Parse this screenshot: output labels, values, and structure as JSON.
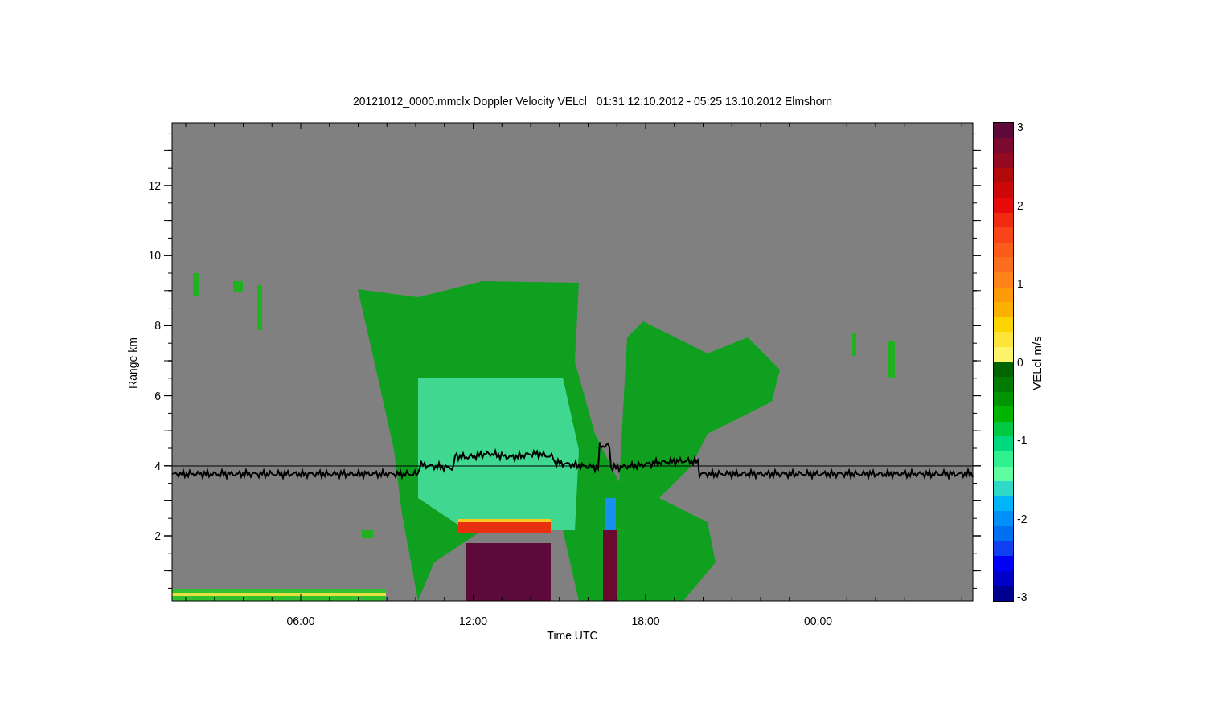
{
  "title": "20121012_0000.mmclx Doppler Velocity VELcl   01:31 12.10.2012 - 05:25 13.10.2012 Elmshorn",
  "y_axis": {
    "label": "Range km",
    "ticks": [
      "12",
      "10",
      "8",
      "6",
      "4",
      "2"
    ]
  },
  "x_axis": {
    "label": "Time UTC",
    "ticks": [
      "06:00",
      "12:00",
      "18:00",
      "00:00"
    ]
  },
  "colorbar": {
    "label": "VELcl m/s",
    "ticks": [
      "3",
      "2",
      "1",
      "0",
      "-1",
      "-2",
      "-3"
    ],
    "segments": [
      {
        "color": "#5c0a3a"
      },
      {
        "color": "#7a0a30"
      },
      {
        "color": "#940a22"
      },
      {
        "color": "#b00a0a"
      },
      {
        "color": "#cc0808"
      },
      {
        "color": "#e60a0a"
      },
      {
        "color": "#f02a10"
      },
      {
        "color": "#f84418"
      },
      {
        "color": "#fa5a1a"
      },
      {
        "color": "#fc6e1e"
      },
      {
        "color": "#fc8418"
      },
      {
        "color": "#fc9a0a"
      },
      {
        "color": "#fcb000"
      },
      {
        "color": "#fcd400"
      },
      {
        "color": "#fce43a"
      },
      {
        "color": "#fcf46a"
      },
      {
        "color": "#006400"
      },
      {
        "color": "#007a00"
      },
      {
        "color": "#009400"
      },
      {
        "color": "#00b400"
      },
      {
        "color": "#00c840"
      },
      {
        "color": "#00d880"
      },
      {
        "color": "#30f090"
      },
      {
        "color": "#60fca0"
      },
      {
        "color": "#30d8c8"
      },
      {
        "color": "#00b4f8"
      },
      {
        "color": "#0090f8"
      },
      {
        "color": "#0070f0"
      },
      {
        "color": "#1040f0"
      },
      {
        "color": "#0000f8"
      },
      {
        "color": "#0000c8"
      },
      {
        "color": "#000090"
      }
    ]
  }
}
